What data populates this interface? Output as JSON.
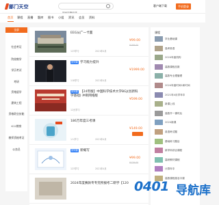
{
  "header": {
    "logo_text": "鄙门天空",
    "search_placeholder": "搜索您需的课",
    "client_label": "客户端下载",
    "login_label": "手机登录"
  },
  "nav": {
    "tabs": [
      {
        "label": "首页",
        "active": true
      },
      {
        "label": "课程",
        "active": false
      },
      {
        "label": "直播",
        "active": false
      },
      {
        "label": "题库",
        "active": false
      },
      {
        "label": "图书",
        "active": false
      },
      {
        "label": "小组",
        "active": false
      },
      {
        "label": "资讯",
        "active": false
      },
      {
        "label": "会员",
        "active": false
      },
      {
        "label": "资料",
        "active": false
      }
    ]
  },
  "sidebar": {
    "items": [
      {
        "label": "全部",
        "active": true
      },
      {
        "label": "社会考证",
        "active": false
      },
      {
        "label": "院校教学",
        "active": false
      },
      {
        "label": "学历考试",
        "active": false
      },
      {
        "label": "考研",
        "active": false
      },
      {
        "label": "资格留学",
        "active": false
      },
      {
        "label": "建筑工程",
        "active": false
      },
      {
        "label": "资格职业技能",
        "active": false
      },
      {
        "label": "K12教育",
        "active": false
      },
      {
        "label": "教师资格考证",
        "active": false
      },
      {
        "label": "公务员",
        "active": false
      }
    ]
  },
  "courses": [
    {
      "badge": "",
      "title": "EEG从广一卡置",
      "price": "¥99.00",
      "orig": "¥199.00",
      "meta1": "123学习",
      "meta2": "",
      "meta3": "2021年4月"
    },
    {
      "badge": "系列课",
      "title": "学习能力提升",
      "price": "¥1999.00",
      "orig": "",
      "meta1": "118学习",
      "meta2": "",
      "meta3": "2021年4月"
    },
    {
      "badge": "系列课",
      "title": "【24年版】中国科学技术大学BGJ(创新科学基础) 冲刺网络版",
      "price": "¥599.00",
      "orig": "",
      "meta1": "12元学习",
      "meta2": "",
      "meta3": ""
    },
    {
      "badge": "",
      "title": "186万年度三考课",
      "price": "¥149.00",
      "orig": "",
      "meta1": "1人学习",
      "meta2": "",
      "meta3": "2021年4月"
    },
    {
      "badge": "系列课",
      "title": "新概写",
      "price": "¥99.00",
      "orig": "¥129.00",
      "meta1": "123学习",
      "meta2": "",
      "meta3": "2021年4月"
    },
    {
      "badge": "",
      "title": "2024年度赛款专专究所报考二研学【120",
      "price": "",
      "orig": "",
      "meta1": "",
      "meta2": "",
      "meta3": ""
    }
  ],
  "right_panel": {
    "title": "课程",
    "items": [
      "学业基础课",
      "高考英语",
      "2024年度机构",
      "高数课程总数",
      "高数专业理管理",
      "2024年度时间1和时间",
      "2021年4月学年中",
      "新课上线",
      "高数开一课时后",
      "2024新课",
      "英语考试题",
      "基础练习题目",
      "新学科综合课程",
      "高研教材课程",
      "计算年中",
      "高数课程报名中课"
    ]
  },
  "watermark": {
    "domain": "0401",
    "text": "导航库"
  },
  "colors": {
    "accent": "#f26b1d",
    "badge_blue": "#2e7df6",
    "watermark_blue": "#1a6fc9"
  }
}
